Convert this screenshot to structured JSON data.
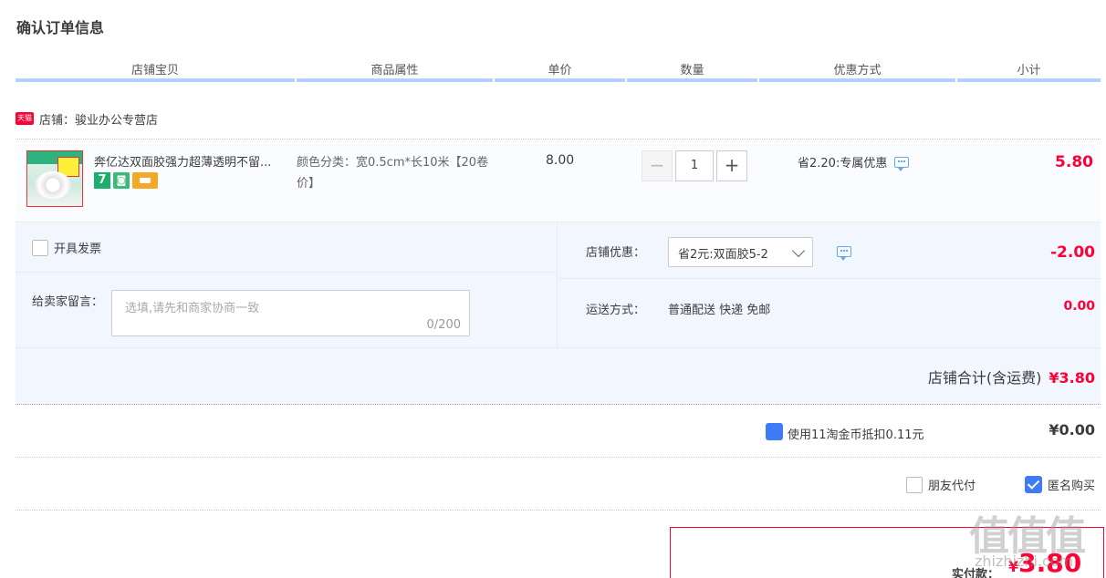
{
  "page": {
    "title": "确认订单信息"
  },
  "columns": [
    "店铺宝贝",
    "商品属性",
    "单价",
    "数量",
    "优惠方式",
    "小计"
  ],
  "shop": {
    "badge": "天猫",
    "label": "店铺：骏业办公专营店"
  },
  "item": {
    "name": "奔亿达双面胶强力超薄透明不留...",
    "badge_number": "7",
    "attribute": "颜色分类：宽0.5cm*长10米【20卷价】",
    "price": "8.00",
    "quantity": "1",
    "minus": "−",
    "plus": "+",
    "promo": "省2.20:专属优惠",
    "subtotal": "5.80"
  },
  "extras": {
    "invoice_label": "开具发票",
    "message_label": "给卖家留言：",
    "message_placeholder": "选填,请先和商家协商一致",
    "message_count": "0/200",
    "shop_discount_label": "店铺优惠：",
    "shop_discount_value": "省2元:双面胶5-2",
    "shop_discount_amount": "-2.00",
    "shipping_label": "运送方式：",
    "shipping_value": "普通配送 快递 免邮",
    "shipping_amount": "0.00",
    "shop_total_label": "店铺合计(含运费)",
    "shop_total_amount": "¥3.80"
  },
  "coins": {
    "text": "使用11淘金币抵扣0.11元",
    "amount": "¥0.00"
  },
  "options": {
    "friend_pay": "朋友代付",
    "anonymous": "匿名购买"
  },
  "payment": {
    "label": "实付款：",
    "currency": "¥",
    "amount": "3.80"
  },
  "watermark": {
    "main": "值值值",
    "sub": "zhizhizhi.com"
  },
  "colors": {
    "accent": "#ff0036",
    "header_bar": "#b2d1ff",
    "band": "#f2f7ff",
    "check": "#3e7bf5"
  }
}
